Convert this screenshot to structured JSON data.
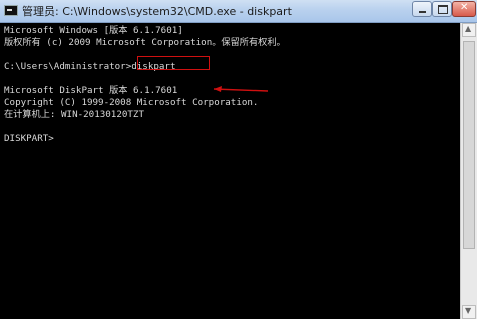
{
  "window": {
    "title": "管理员: C:\\Windows\\system32\\CMD.exe - diskpart",
    "controls": [
      "minimize",
      "maximize",
      "close"
    ]
  },
  "console": {
    "lines": [
      "Microsoft Windows [版本 6.1.7601]",
      "版权所有 (c) 2009 Microsoft Corporation。保留所有权利。",
      "",
      "C:\\Users\\Administrator>diskpart",
      "",
      "Microsoft DiskPart 版本 6.1.7601",
      "Copyright (C) 1999-2008 Microsoft Corporation.",
      "在计算机上: WIN-20130120TZT",
      "",
      "DISKPART>"
    ]
  },
  "annotation": {
    "highlight_text": "diskpart",
    "arrow_color": "#d01010"
  }
}
